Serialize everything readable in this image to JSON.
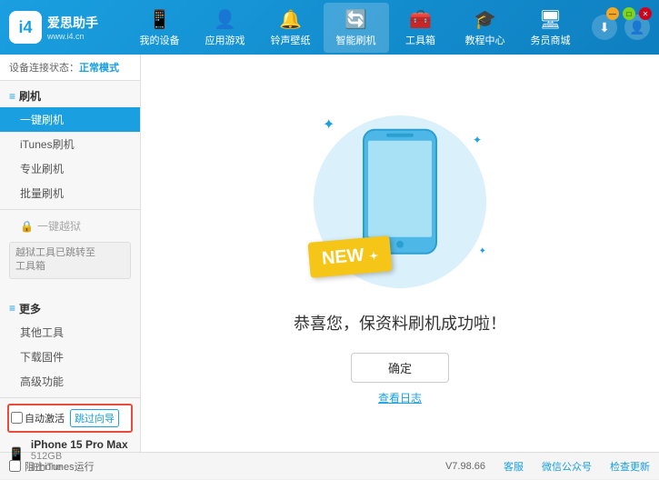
{
  "app": {
    "logo_icon": "i4",
    "logo_name": "爱思助手",
    "logo_url": "www.i4.cn"
  },
  "nav": {
    "tabs": [
      {
        "id": "my-device",
        "icon": "📱",
        "label": "我的设备"
      },
      {
        "id": "app-game",
        "icon": "👤",
        "label": "应用游戏"
      },
      {
        "id": "ringtone",
        "icon": "🔔",
        "label": "铃声壁纸"
      },
      {
        "id": "smart-flash",
        "icon": "🔄",
        "label": "智能刷机",
        "active": true
      },
      {
        "id": "toolbox",
        "icon": "🧰",
        "label": "工具箱"
      },
      {
        "id": "tutorial",
        "icon": "🎓",
        "label": "教程中心"
      },
      {
        "id": "service",
        "icon": "🖥",
        "label": "务员商城"
      }
    ]
  },
  "status": {
    "prefix": "设备连接状态：",
    "mode": "正常模式"
  },
  "sidebar": {
    "flash_section": "刷机",
    "items": [
      {
        "id": "one-click-flash",
        "label": "一键刷机",
        "active": true
      },
      {
        "id": "itunes-flash",
        "label": "iTunes刷机",
        "active": false
      },
      {
        "id": "pro-flash",
        "label": "专业刷机",
        "active": false
      },
      {
        "id": "batch-flash",
        "label": "批量刷机",
        "active": false
      }
    ],
    "disabled_label": "一键越狱",
    "notice_text": "越狱工具已跳转至\n工具箱",
    "more_section": "更多",
    "more_items": [
      {
        "id": "other-tools",
        "label": "其他工具"
      },
      {
        "id": "download-firmware",
        "label": "下载固件"
      },
      {
        "id": "advanced",
        "label": "高级功能"
      }
    ],
    "auto_activate_label": "自动激活",
    "manual_guide_label": "跳过向导",
    "device_name": "iPhone 15 Pro Max",
    "device_storage": "512GB",
    "device_type": "iPhone"
  },
  "main": {
    "new_badge": "NEW",
    "success_text": "恭喜您，保资料刷机成功啦！",
    "confirm_btn": "确定",
    "log_link": "查看日志"
  },
  "footer": {
    "version": "V7.98.66",
    "skin_label": "客服",
    "wechat_label": "微信公众号",
    "check_update_label": "检查更新",
    "stop_itunes_label": "阻止iTunes运行"
  },
  "win_controls": {
    "min": "—",
    "max": "□",
    "close": "✕"
  }
}
